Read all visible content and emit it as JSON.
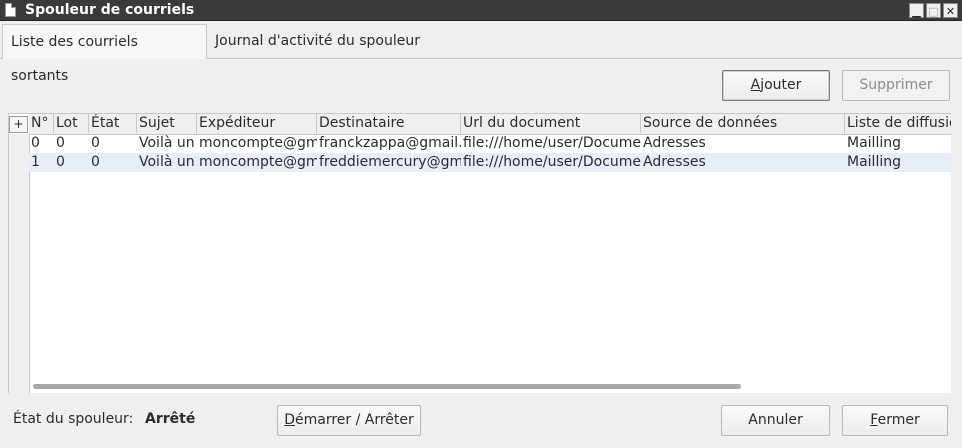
{
  "window": {
    "title": "Spouleur de courriels"
  },
  "tabs": [
    {
      "label": "Liste des courriels sortants",
      "active": true
    },
    {
      "label": "Journal d'activité du spouleur",
      "active": false
    }
  ],
  "buttons": {
    "add": {
      "label_u": "A",
      "label_rest": "jouter"
    },
    "delete": {
      "label": "Supprimer"
    },
    "start_stop": {
      "label_u": "D",
      "label_rest": "émarrer / Arrêter"
    },
    "cancel": {
      "label": "Annuler"
    },
    "close": {
      "label_u": "F",
      "label_rest": "ermer"
    }
  },
  "grid": {
    "corner": "+",
    "columns": [
      "N°",
      "Lot",
      "État",
      "Sujet",
      "Expéditeur",
      "Destinataire",
      "Url du document",
      "Source de données",
      "Liste de diffusion"
    ],
    "rows": [
      [
        "0",
        "0",
        "0",
        "Voilà un",
        "moncompte@gm",
        "franckzappa@gmail.",
        "file:///home/user/Docume",
        "Adresses",
        "Mailling"
      ],
      [
        "1",
        "0",
        "0",
        "Voilà un",
        "moncompte@gm",
        "freddiemercury@gm",
        "file:///home/user/Docume",
        "Adresses",
        "Mailling"
      ]
    ]
  },
  "status": {
    "label": "État du spouleur:",
    "value": "Arrêté"
  },
  "colors": {
    "titlebar": "#3a3a3a",
    "row_alt": "#e8eef7",
    "accent_border": "#7a7a7a"
  }
}
